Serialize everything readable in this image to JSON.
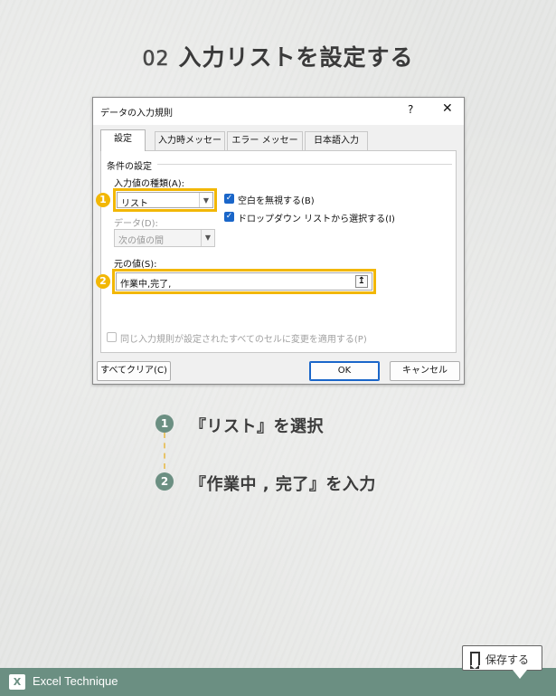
{
  "heading": {
    "number": "02",
    "title": "入力リストを設定する"
  },
  "dialog": {
    "title": "データの入力規則",
    "help": "?",
    "close": "✕",
    "tabs": [
      "設定",
      "入力時メッセージ",
      "エラー メッセージ",
      "日本語入力"
    ],
    "section_label": "条件の設定",
    "allow_label": "入力値の種類(A):",
    "allow_value": "リスト",
    "ignore_blank": "空白を無視する(B)",
    "dropdown": "ドロップダウン リストから選択する(I)",
    "data_label": "データ(D):",
    "data_value": "次の値の間",
    "source_label": "元の値(S):",
    "source_value": "作業中,完了,",
    "apply_all": "同じ入力規則が設定されたすべてのセルに変更を適用する(P)",
    "clear_all": "すべてクリア(C)",
    "ok": "OK",
    "cancel": "キャンセル"
  },
  "badges": [
    "1",
    "2"
  ],
  "steps": [
    {
      "marker": "1",
      "text": "『リスト』を選択"
    },
    {
      "marker": "2",
      "text": "『作業中 , 完了』を入力"
    }
  ],
  "save_label": "保存する",
  "footer": {
    "icon": "X",
    "label": "Excel Technique"
  },
  "colors": {
    "accent": "#f2b705",
    "teal": "#6b8f82",
    "blue": "#1a66c9"
  }
}
